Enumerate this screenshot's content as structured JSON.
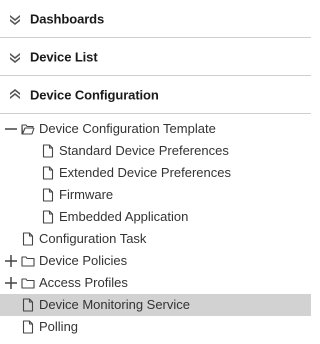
{
  "sections": [
    {
      "label": "Dashboards",
      "state": "collapsed",
      "icon": "chevron-double-down-icon"
    },
    {
      "label": "Device List",
      "state": "collapsed",
      "icon": "chevron-double-down-icon"
    },
    {
      "label": "Device Configuration",
      "state": "expanded",
      "icon": "chevron-double-up-icon"
    }
  ],
  "tree": {
    "items": [
      {
        "label": "Device Configuration Template",
        "icon": "folder-open-icon",
        "toggle": "minus-icon",
        "level": 0
      },
      {
        "label": "Standard Device Preferences",
        "icon": "file-icon",
        "level": 1
      },
      {
        "label": "Extended Device Preferences",
        "icon": "file-icon",
        "level": 1
      },
      {
        "label": "Firmware",
        "icon": "file-icon",
        "level": 1
      },
      {
        "label": "Embedded Application",
        "icon": "file-icon",
        "level": 1
      },
      {
        "label": "Configuration Task",
        "icon": "file-icon",
        "level": 0
      },
      {
        "label": "Device Policies",
        "icon": "folder-icon",
        "toggle": "plus-icon",
        "level": 0
      },
      {
        "label": "Access Profiles",
        "icon": "folder-icon",
        "toggle": "plus-icon",
        "level": 0
      },
      {
        "label": "Device Monitoring Service",
        "icon": "file-icon",
        "level": 0,
        "selected": true
      },
      {
        "label": "Polling",
        "icon": "file-icon",
        "level": 0
      }
    ]
  },
  "colors": {
    "selected_background": "#d2d2d2",
    "divider": "#cfcfcf",
    "icon_stroke": "#444444"
  }
}
